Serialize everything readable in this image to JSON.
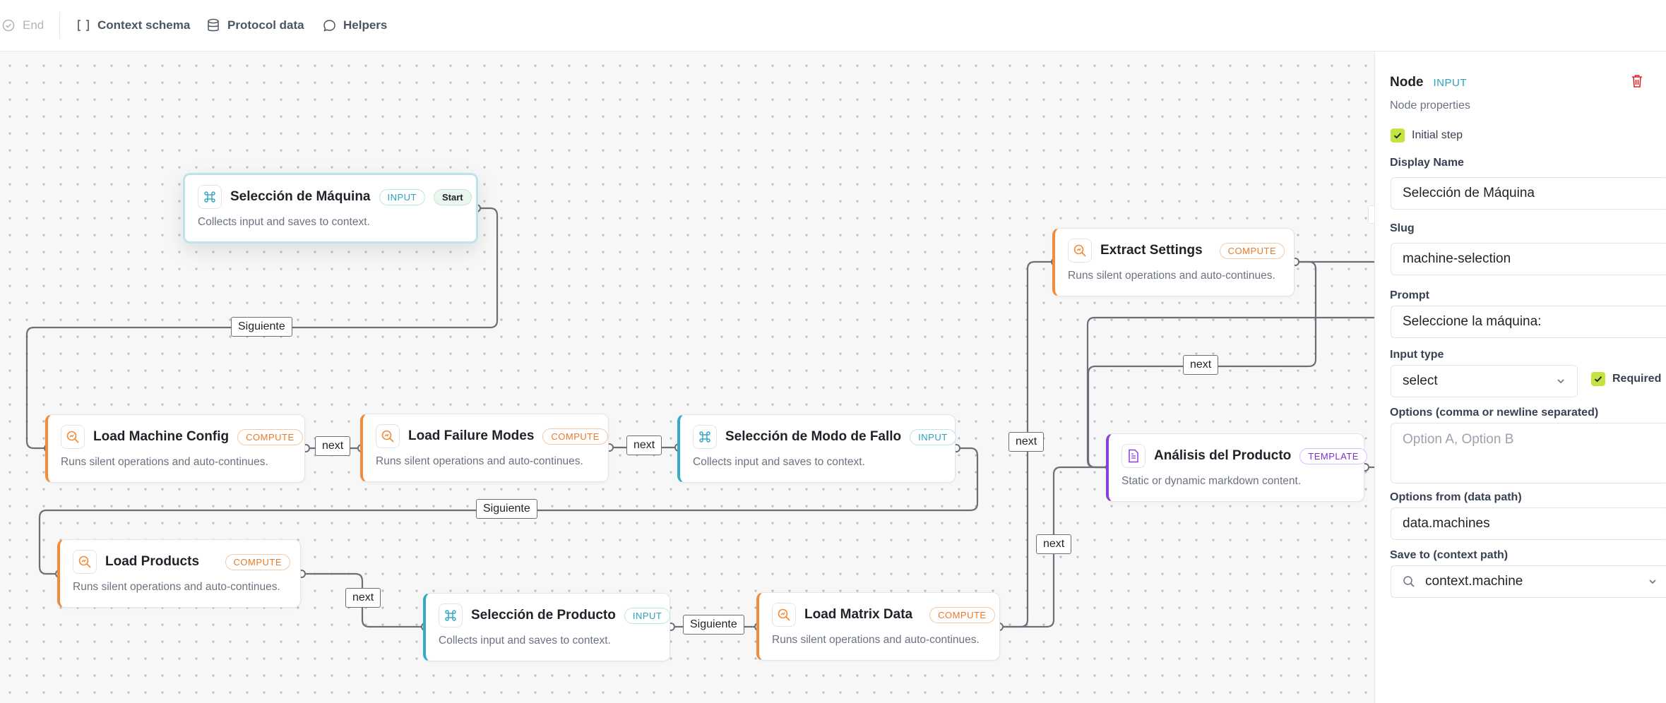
{
  "toolbar": {
    "end": "End",
    "context_schema": "Context schema",
    "protocol_data": "Protocol data",
    "helpers": "Helpers"
  },
  "nodes": {
    "seleccion_maquina": {
      "title": "Selección de Máquina",
      "badge": "INPUT",
      "start": "Start",
      "desc": "Collects input and saves to context."
    },
    "load_machine_config": {
      "title": "Load Machine Config",
      "badge": "COMPUTE",
      "desc": "Runs silent operations and auto-continues."
    },
    "load_failure_modes": {
      "title": "Load Failure Modes",
      "badge": "COMPUTE",
      "desc": "Runs silent operations and auto-continues."
    },
    "seleccion_modo_fallo": {
      "title": "Selección de Modo de Fallo",
      "badge": "INPUT",
      "desc": "Collects input and saves to context."
    },
    "load_products": {
      "title": "Load Products",
      "badge": "COMPUTE",
      "desc": "Runs silent operations and auto-continues."
    },
    "seleccion_producto": {
      "title": "Selección de Producto",
      "badge": "INPUT",
      "desc": "Collects input and saves to context."
    },
    "load_matrix_data": {
      "title": "Load Matrix Data",
      "badge": "COMPUTE",
      "desc": "Runs silent operations and auto-continues."
    },
    "extract_settings": {
      "title": "Extract Settings",
      "badge": "COMPUTE",
      "desc": "Runs silent operations and auto-continues."
    },
    "analisis_producto": {
      "title": "Análisis del Producto",
      "badge": "TEMPLATE",
      "desc": "Static or dynamic markdown content."
    }
  },
  "edges": {
    "siguiente_1": "Siguiente",
    "next_1": "next",
    "next_2": "next",
    "siguiente_2": "Siguiente",
    "next_3": "next",
    "siguiente_3": "Siguiente",
    "next_4": "next",
    "next_5": "next",
    "next_6": "next"
  },
  "panel": {
    "title": "Node",
    "type_badge": "INPUT",
    "subtitle": "Node properties",
    "initial_step_label": "Initial step",
    "initial_step_checked": true,
    "display_name_label": "Display Name",
    "display_name_value": "Selección de Máquina",
    "slug_label": "Slug",
    "slug_value": "machine-selection",
    "prompt_label": "Prompt",
    "prompt_value": "Seleccione la máquina:",
    "input_type_label": "Input type",
    "input_type_value": "select",
    "required_label": "Required",
    "required_checked": true,
    "options_label": "Options (comma or newline separated)",
    "options_placeholder": "Option A, Option B",
    "options_from_label": "Options from (data path)",
    "options_from_value": "data.machines",
    "save_to_label": "Save to (context path)",
    "save_to_value": "context.machine"
  },
  "colors": {
    "compute": "#f08c3a",
    "input": "#35a9c6",
    "template": "#8b3fd9",
    "checkbox": "#c3e340",
    "delete": "#dc2626"
  }
}
